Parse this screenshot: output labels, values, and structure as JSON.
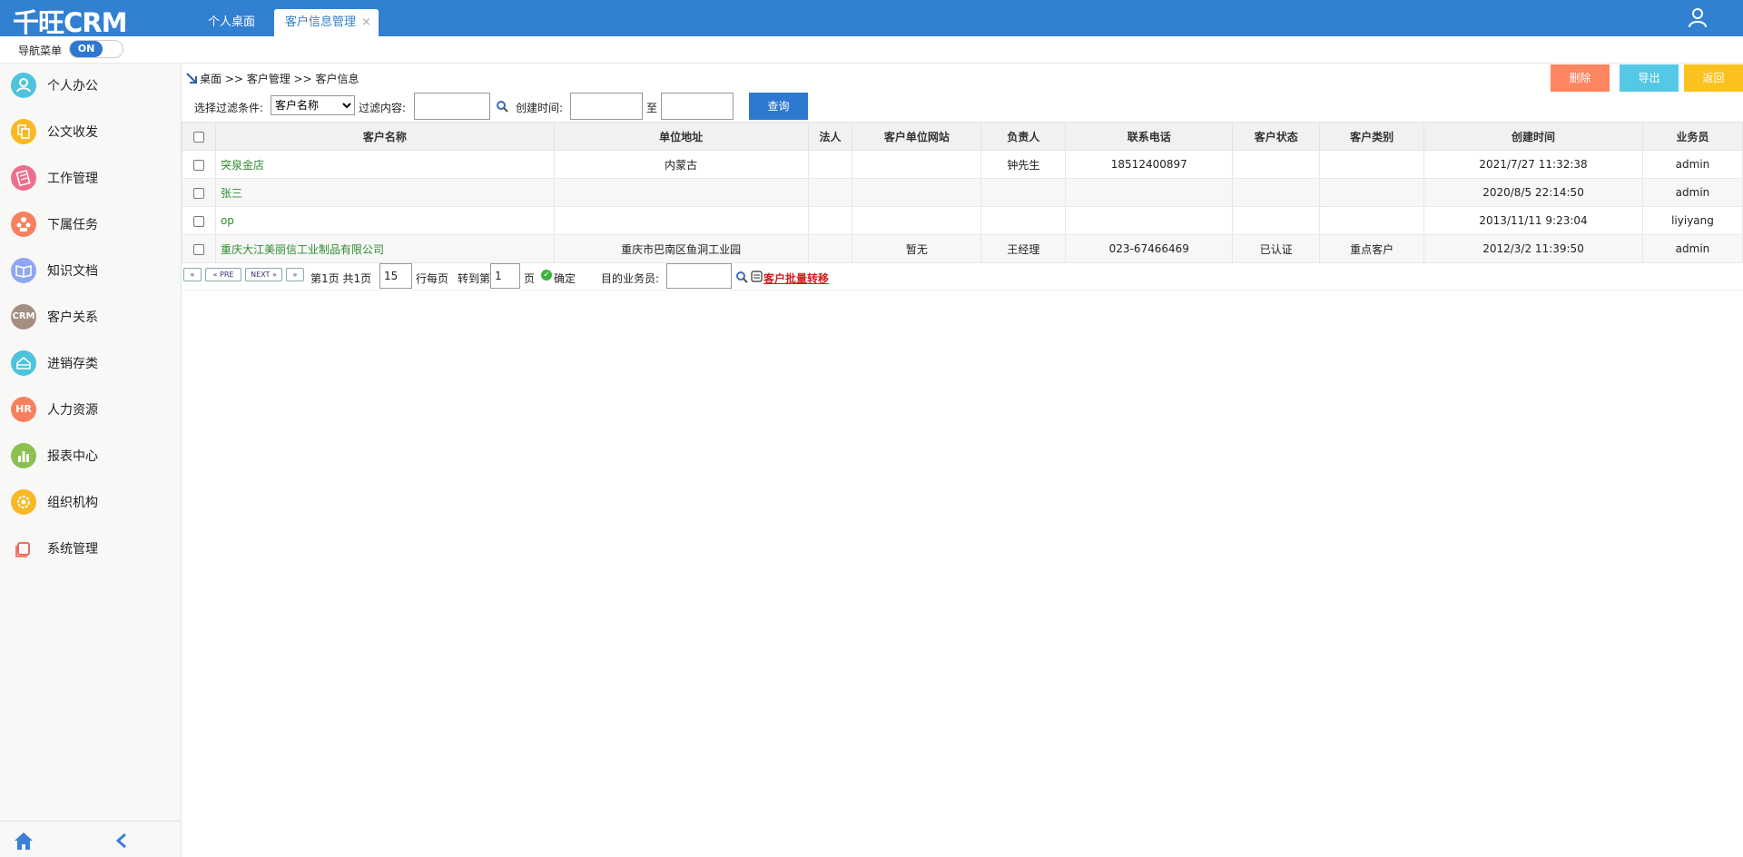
{
  "app": {
    "logo": "千旺CRM",
    "tabs": [
      {
        "label": "个人桌面"
      },
      {
        "label": "客户信息管理",
        "close": "×"
      }
    ]
  },
  "nav_toggle": {
    "label": "导航菜单",
    "state": "ON"
  },
  "sidebar": {
    "items": [
      {
        "label": "个人办公",
        "icon": "person-icon",
        "color": "#4fc3dd"
      },
      {
        "label": "公文收发",
        "icon": "document-exchange-icon",
        "color": "#f9b824"
      },
      {
        "label": "工作管理",
        "icon": "notebook-icon",
        "color": "#ec6e8d"
      },
      {
        "label": "下属任务",
        "icon": "team-task-icon",
        "color": "#f7815e"
      },
      {
        "label": "知识文档",
        "icon": "book-icon",
        "color": "#8fa7f2"
      },
      {
        "label": "客户关系",
        "icon": "crm-icon",
        "icon_text": "CRM",
        "color": "#a48f82"
      },
      {
        "label": "进销存类",
        "icon": "inventory-icon",
        "color": "#4fc3dd"
      },
      {
        "label": "人力资源",
        "icon": "hr-icon",
        "icon_text": "HR",
        "color": "#f7815e"
      },
      {
        "label": "报表中心",
        "icon": "bar-chart-icon",
        "color": "#8cc152"
      },
      {
        "label": "组织机构",
        "icon": "gear-icon",
        "color": "#f9b824"
      },
      {
        "label": "系统管理",
        "icon": "window-icon",
        "color": "#ee5a4a"
      }
    ]
  },
  "breadcrumb": {
    "text": "桌面 >> 客户管理 >> 客户信息"
  },
  "actions": {
    "delete": "删除",
    "export": "导出",
    "back": "返回"
  },
  "filter": {
    "condition_label": "选择过滤条件:",
    "condition_value": "客户名称",
    "content_label": "过滤内容:",
    "created_label": "创建时间:",
    "to_label": "至",
    "query_button": "查询"
  },
  "table": {
    "columns": [
      "客户名称",
      "单位地址",
      "法人",
      "客户单位网站",
      "负责人",
      "联系电话",
      "客户状态",
      "客户类别",
      "创建时间",
      "业务员"
    ],
    "rows": [
      [
        "突泉金店",
        "内蒙古",
        "",
        "",
        "钟先生",
        "18512400897",
        "",
        "",
        "2021/7/27 11:32:38",
        "admin"
      ],
      [
        "张三",
        "",
        "",
        "",
        "",
        "",
        "",
        "",
        "2020/8/5 22:14:50",
        "admin"
      ],
      [
        "op",
        "",
        "",
        "",
        "",
        "",
        "",
        "",
        "2013/11/11 9:23:04",
        "liyiyang"
      ],
      [
        "重庆大江美丽信工业制品有限公司",
        "重庆市巴南区鱼洞工业园",
        "",
        "暂无",
        "王经理",
        "023-67466469",
        "已认证",
        "重点客户",
        "2012/3/2 11:39:50",
        "admin"
      ]
    ]
  },
  "pager": {
    "first": "«",
    "prev": "« PRE",
    "next": "NEXT »",
    "last": "»",
    "page_info": "第1页 共1页",
    "rows_per_page": "15",
    "rows_label": "行每页",
    "goto_label": "转到第",
    "goto_value": "1",
    "page_suffix": "页",
    "confirm": "确定",
    "target_label": "目的业务员:",
    "transfer_link": "客户批量转移"
  }
}
